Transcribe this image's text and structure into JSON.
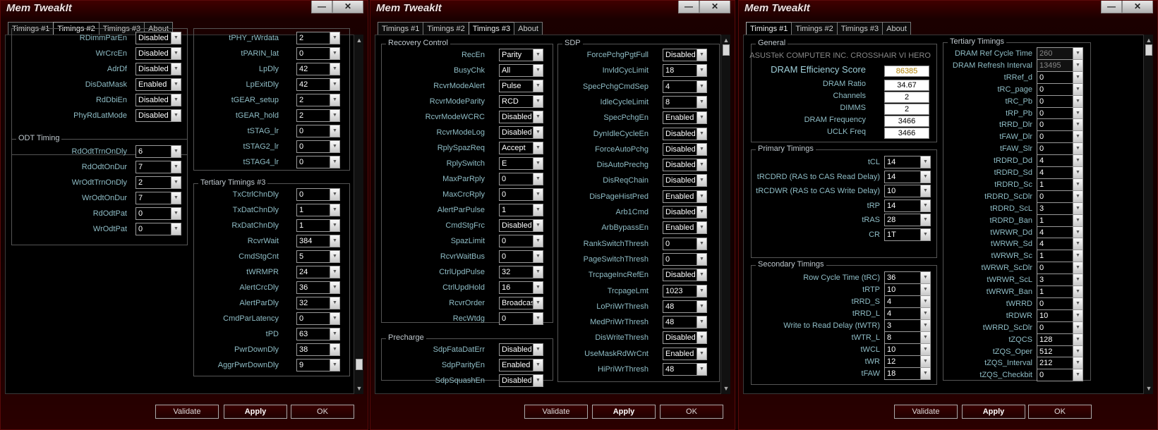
{
  "win1": {
    "title": "Mem TweakIt",
    "tabs": [
      "Timings #1",
      "Timings #2",
      "Timings #3",
      "About"
    ],
    "active": 1,
    "top_left": [
      {
        "label": "RDimmParEn",
        "value": "Disabled"
      },
      {
        "label": "WrCrcEn",
        "value": "Disabled"
      },
      {
        "label": "AdrDf",
        "value": "Disabled"
      },
      {
        "label": "DisDatMask",
        "value": "Enabled"
      },
      {
        "label": "RdDbiEn",
        "value": "Disabled"
      },
      {
        "label": "PhyRdLatMode",
        "value": "Disabled"
      }
    ],
    "odt": {
      "title": "ODT Timing",
      "items": [
        {
          "label": "RdOdtTrnOnDly",
          "value": "6"
        },
        {
          "label": "RdOdtOnDur",
          "value": "7"
        },
        {
          "label": "WrOdtTrnOnDly",
          "value": "2"
        },
        {
          "label": "WrOdtOnDur",
          "value": "7"
        },
        {
          "label": "RdOdtPat",
          "value": "0"
        },
        {
          "label": "WrOdtPat",
          "value": "0"
        }
      ]
    },
    "top_right": [
      {
        "label": "tPHY_rWrdata",
        "value": "2"
      },
      {
        "label": "tPARIN_lat",
        "value": "0"
      },
      {
        "label": "LpDly",
        "value": "42"
      },
      {
        "label": "LpExitDly",
        "value": "42"
      },
      {
        "label": "tGEAR_setup",
        "value": "2"
      },
      {
        "label": "tGEAR_hold",
        "value": "2"
      },
      {
        "label": "tSTAG_lr",
        "value": "0"
      },
      {
        "label": "tSTAG2_lr",
        "value": "0"
      },
      {
        "label": "tSTAG4_lr",
        "value": "0"
      }
    ],
    "tert3": {
      "title": "Tertiary Timings #3",
      "items": [
        {
          "label": "TxCtrlChnDly",
          "value": "0"
        },
        {
          "label": "TxDatChnDly",
          "value": "1"
        },
        {
          "label": "RxDatChnDly",
          "value": "1"
        },
        {
          "label": "RcvrWait",
          "value": "384"
        },
        {
          "label": "CmdStgCnt",
          "value": "5"
        },
        {
          "label": "tWRMPR",
          "value": "24"
        },
        {
          "label": "AlertCrcDly",
          "value": "36"
        },
        {
          "label": "AlertParDly",
          "value": "32"
        },
        {
          "label": "CmdParLatency",
          "value": "0"
        },
        {
          "label": "tPD",
          "value": "63"
        },
        {
          "label": "PwrDownDly",
          "value": "38"
        },
        {
          "label": "AggrPwrDownDly",
          "value": "9"
        }
      ]
    },
    "buttons": {
      "validate": "Validate",
      "apply": "Apply",
      "ok": "OK"
    }
  },
  "win2": {
    "title": "Mem TweakIt",
    "tabs": [
      "Timings #1",
      "Timings #2",
      "Timings #3",
      "About"
    ],
    "active": 2,
    "recovery": {
      "title": "Recovery Control",
      "items": [
        {
          "label": "RecEn",
          "value": "Parity"
        },
        {
          "label": "BusyChk",
          "value": "All"
        },
        {
          "label": "RcvrModeAlert",
          "value": "Pulse"
        },
        {
          "label": "RcvrModeParity",
          "value": "RCD"
        },
        {
          "label": "RcvrModeWCRC",
          "value": "Disabled"
        },
        {
          "label": "RcvrModeLog",
          "value": "Disabled"
        },
        {
          "label": "RplySpazReq",
          "value": "Accept"
        },
        {
          "label": "RplySwitch",
          "value": "E"
        },
        {
          "label": "MaxParRply",
          "value": "0"
        },
        {
          "label": "MaxCrcRply",
          "value": "0"
        },
        {
          "label": "AlertParPulse",
          "value": "1"
        },
        {
          "label": "CmdStgFrc",
          "value": "Disabled"
        },
        {
          "label": "SpazLimit",
          "value": "0"
        },
        {
          "label": "RcvrWaitBus",
          "value": "0"
        },
        {
          "label": "CtrlUpdPulse",
          "value": "32"
        },
        {
          "label": "CtrlUpdHold",
          "value": "16"
        },
        {
          "label": "RcvrOrder",
          "value": "Broadcast"
        },
        {
          "label": "RecWtdg",
          "value": "0"
        }
      ]
    },
    "precharge": {
      "title": "Precharge",
      "items": [
        {
          "label": "SdpFataDatErr",
          "value": "Disabled"
        },
        {
          "label": "SdpParityEn",
          "value": "Enabled"
        },
        {
          "label": "SdpSquashEn",
          "value": "Disabled"
        }
      ]
    },
    "sdp": {
      "title": "SDP",
      "items": [
        {
          "label": "ForcePchgPgtFull",
          "value": "Disabled"
        },
        {
          "label": "InvldCycLimit",
          "value": "18"
        },
        {
          "label": "SpecPchgCmdSep",
          "value": "4"
        },
        {
          "label": "IdleCycleLimit",
          "value": "8"
        },
        {
          "label": "SpecPchgEn",
          "value": "Enabled"
        },
        {
          "label": "DynIdleCycleEn",
          "value": "Disabled"
        },
        {
          "label": "ForceAutoPchg",
          "value": "Disabled"
        },
        {
          "label": "DisAutoPrechg",
          "value": "Disabled"
        },
        {
          "label": "DisReqChain",
          "value": "Disabled"
        },
        {
          "label": "DisPageHistPred",
          "value": "Enabled"
        },
        {
          "label": "Arb1Cmd",
          "value": "Disabled"
        },
        {
          "label": "ArbBypassEn",
          "value": "Enabled"
        },
        {
          "label": "RankSwitchThresh",
          "value": "0"
        },
        {
          "label": "PageSwitchThresh",
          "value": "0"
        },
        {
          "label": "TrcpageIncRefEn",
          "value": "Disabled"
        },
        {
          "label": "TrcpageLmt",
          "value": "1023"
        },
        {
          "label": "LoPriWrThresh",
          "value": "48"
        },
        {
          "label": "MedPriWrThresh",
          "value": "48"
        },
        {
          "label": "DisWriteThresh",
          "value": "Disabled"
        },
        {
          "label": "UseMaskRdWrCnt",
          "value": "Enabled"
        },
        {
          "label": "HiPriWrThresh",
          "value": "48"
        }
      ]
    },
    "buttons": {
      "validate": "Validate",
      "apply": "Apply",
      "ok": "OK"
    }
  },
  "win3": {
    "title": "Mem TweakIt",
    "tabs": [
      "Timings #1",
      "Timings #2",
      "Timings #3",
      "About"
    ],
    "active": 0,
    "general": {
      "title": "General",
      "board": "ASUSTeK COMPUTER INC. CROSSHAIR VI HERO",
      "items": [
        {
          "label": "DRAM Efficiency Score",
          "value": "86385"
        },
        {
          "label": "DRAM Ratio",
          "value": "34.67"
        },
        {
          "label": "Channels",
          "value": "2"
        },
        {
          "label": "DIMMS",
          "value": "2"
        },
        {
          "label": "DRAM Frequency",
          "value": "3466"
        },
        {
          "label": "UCLK Freq",
          "value": "3466"
        }
      ]
    },
    "primary": {
      "title": "Primary Timings",
      "items": [
        {
          "label": "tCL",
          "value": "14"
        },
        {
          "label": "tRCDRD (RAS to CAS Read Delay)",
          "value": "14"
        },
        {
          "label": "tRCDWR (RAS to CAS Write Delay)",
          "value": "10"
        },
        {
          "label": "tRP",
          "value": "14"
        },
        {
          "label": "tRAS",
          "value": "28"
        },
        {
          "label": "CR",
          "value": "1T"
        }
      ]
    },
    "secondary": {
      "title": "Secondary Timings",
      "items": [
        {
          "label": "Row Cycle Time (tRC)",
          "value": "36"
        },
        {
          "label": "tRTP",
          "value": "10"
        },
        {
          "label": "tRRD_S",
          "value": "4"
        },
        {
          "label": "tRRD_L",
          "value": "4"
        },
        {
          "label": "Write to Read Delay (tWTR)",
          "value": "3"
        },
        {
          "label": "tWTR_L",
          "value": "8"
        },
        {
          "label": "tWCL",
          "value": "10"
        },
        {
          "label": "tWR",
          "value": "12"
        },
        {
          "label": "tFAW",
          "value": "18"
        }
      ]
    },
    "tertiary": {
      "title": "Tertiary Timings",
      "items": [
        {
          "label": "DRAM Ref Cycle Time",
          "value": "260"
        },
        {
          "label": "DRAM Refresh Interval",
          "value": "13495"
        },
        {
          "label": "tRRef_d",
          "value": "0"
        },
        {
          "label": "tRC_page",
          "value": "0"
        },
        {
          "label": "tRC_Pb",
          "value": "0"
        },
        {
          "label": "tRP_Pb",
          "value": "0"
        },
        {
          "label": "tRRD_Dlr",
          "value": "0"
        },
        {
          "label": "tFAW_Dlr",
          "value": "0"
        },
        {
          "label": "tFAW_Slr",
          "value": "0"
        },
        {
          "label": "tRDRD_Dd",
          "value": "4"
        },
        {
          "label": "tRDRD_Sd",
          "value": "4"
        },
        {
          "label": "tRDRD_Sc",
          "value": "1"
        },
        {
          "label": "tRDRD_ScDlr",
          "value": "0"
        },
        {
          "label": "tRDRD_ScL",
          "value": "3"
        },
        {
          "label": "tRDRD_Ban",
          "value": "1"
        },
        {
          "label": "tWRWR_Dd",
          "value": "4"
        },
        {
          "label": "tWRWR_Sd",
          "value": "4"
        },
        {
          "label": "tWRWR_Sc",
          "value": "1"
        },
        {
          "label": "tWRWR_ScDlr",
          "value": "0"
        },
        {
          "label": "tWRWR_ScL",
          "value": "3"
        },
        {
          "label": "tWRWR_Ban",
          "value": "1"
        },
        {
          "label": "tWRRD",
          "value": "0"
        },
        {
          "label": "tRDWR",
          "value": "10"
        },
        {
          "label": "tWRRD_ScDlr",
          "value": "0"
        },
        {
          "label": "tZQCS",
          "value": "128"
        },
        {
          "label": "tZQS_Oper",
          "value": "512"
        },
        {
          "label": "tZQS_Interval",
          "value": "212"
        },
        {
          "label": "tZQS_Checkbit",
          "value": "0"
        }
      ]
    },
    "buttons": {
      "validate": "Validate",
      "apply": "Apply",
      "ok": "OK"
    }
  },
  "window_controls": {
    "minimize": "—",
    "close": "✕"
  }
}
